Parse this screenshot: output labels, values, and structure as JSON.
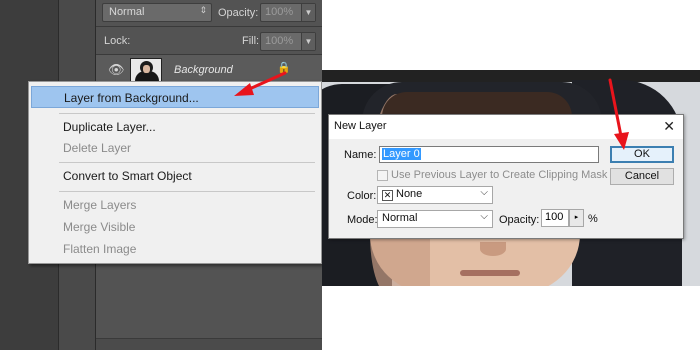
{
  "layers_panel": {
    "blend_mode": "Normal",
    "opacity_label": "Opacity:",
    "opacity_value": "100%",
    "lock_label": "Lock:",
    "fill_label": "Fill:",
    "fill_value": "100%",
    "layer_name": "Background"
  },
  "context_menu": {
    "items": [
      {
        "label": "Layer from Background...",
        "highlighted": true,
        "enabled": true
      },
      {
        "label": "Duplicate Layer...",
        "enabled": true
      },
      {
        "label": "Delete Layer",
        "enabled": false
      },
      {
        "label": "Convert to Smart Object",
        "enabled": true
      },
      {
        "label": "Merge Layers",
        "enabled": false
      },
      {
        "label": "Merge Visible",
        "enabled": false
      },
      {
        "label": "Flatten Image",
        "enabled": false
      }
    ]
  },
  "dialog": {
    "title": "New Layer",
    "name_label": "Name:",
    "name_value": "Layer 0",
    "clip_mask_label": "Use Previous Layer to Create Clipping Mask",
    "color_label": "Color:",
    "color_value": "None",
    "mode_label": "Mode:",
    "mode_value": "Normal",
    "opacity_label": "Opacity:",
    "opacity_value": "100",
    "opacity_unit": "%",
    "ok_label": "OK",
    "cancel_label": "Cancel"
  },
  "colors": {
    "annotation_arrow": "#e8141c",
    "menu_highlight": "#9ec5ef",
    "ps_panel": "#535353"
  }
}
